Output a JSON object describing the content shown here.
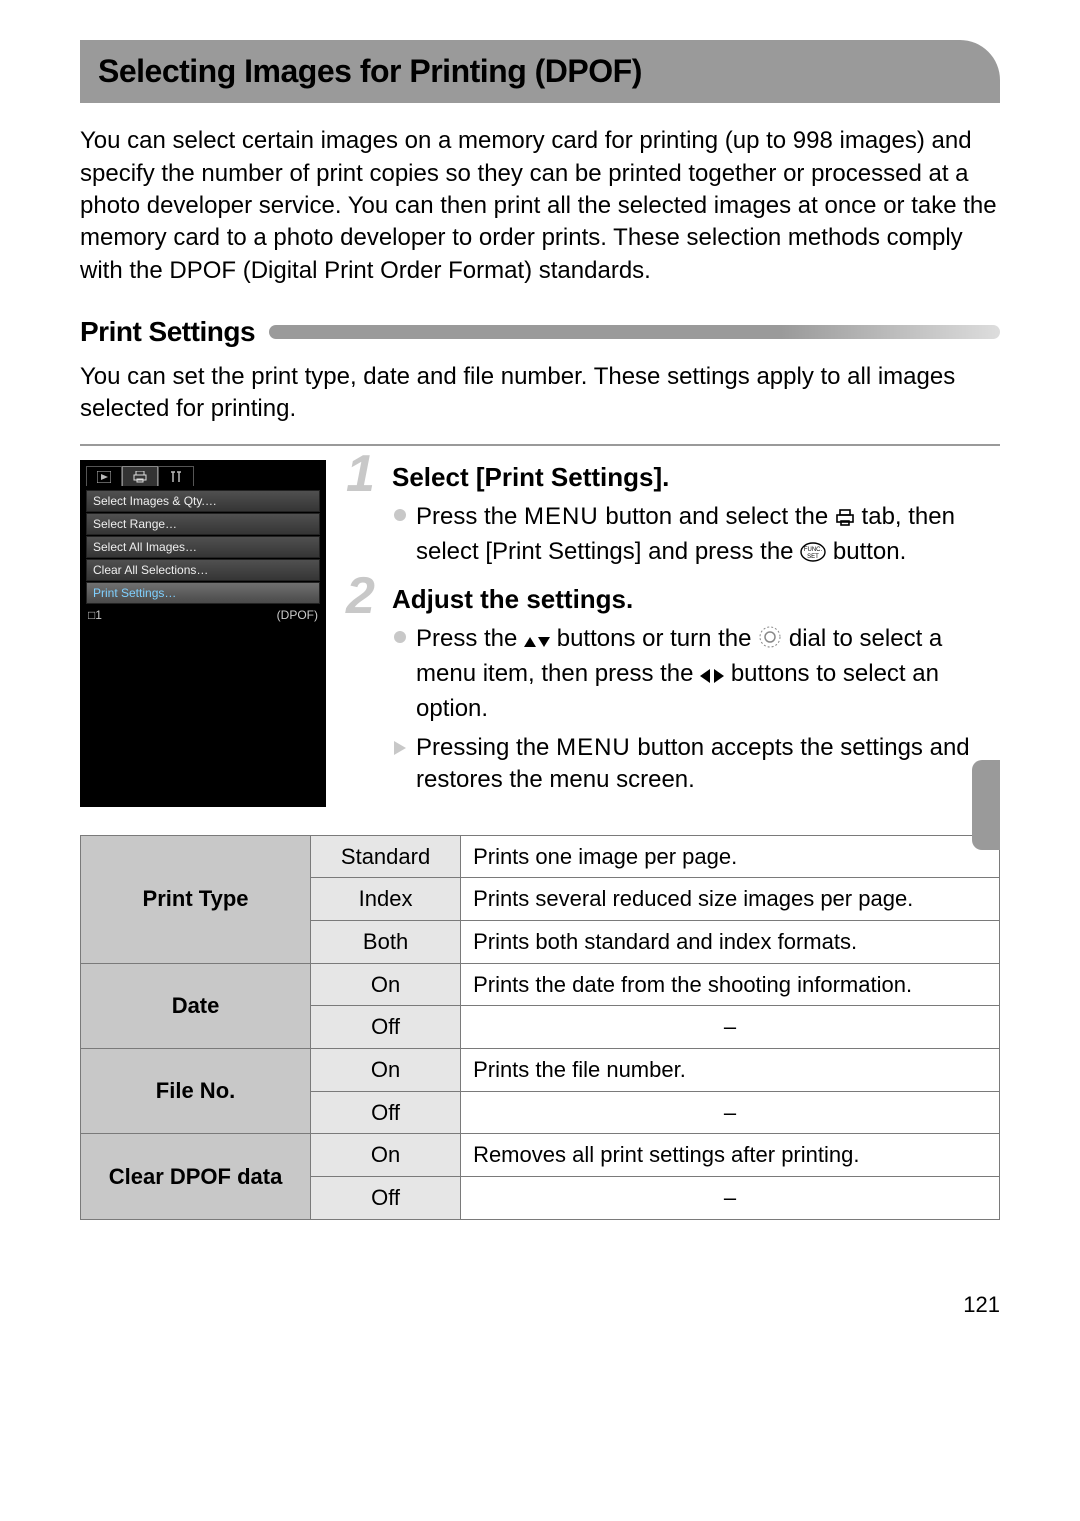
{
  "title": "Selecting Images for Printing (DPOF)",
  "intro": "You can select certain images on a memory card for printing (up to 998 images) and specify the number of print copies so they can be printed together or processed at a photo developer service. You can then print all the selected images at once or take the memory card to a photo developer to order prints. These selection methods comply with the DPOF (Digital Print Order Format) standards.",
  "subtitle": "Print Settings",
  "sub_desc": "You can set the print type, date and file number. These settings apply to all images selected for printing.",
  "camera_menu": {
    "items": [
      "Select Images & Qty.…",
      "Select Range…",
      "Select All Images…",
      "Clear All Selections…",
      "Print Settings…"
    ],
    "footer_left": "□1",
    "footer_right": "(DPOF)"
  },
  "steps": [
    {
      "num": "1",
      "heading": "Select [Print Settings].",
      "bullets": [
        {
          "type": "dot",
          "parts": [
            "Press the ",
            {
              "kind": "menu"
            },
            " button and select the ",
            {
              "kind": "print-icon"
            },
            " tab, then select [Print Settings] and press the ",
            {
              "kind": "func"
            },
            " button."
          ]
        }
      ]
    },
    {
      "num": "2",
      "heading": "Adjust the settings.",
      "bullets": [
        {
          "type": "dot",
          "parts": [
            "Press the ",
            {
              "kind": "updown"
            },
            " buttons or turn the ",
            {
              "kind": "dial"
            },
            " dial to select a menu item, then press the ",
            {
              "kind": "leftright"
            },
            " buttons to select an option."
          ]
        },
        {
          "type": "arrow",
          "parts": [
            "Pressing the ",
            {
              "kind": "menu"
            },
            " button accepts the settings and restores the menu screen."
          ]
        }
      ]
    }
  ],
  "table": [
    {
      "cat": "Print Type",
      "rows": [
        {
          "opt": "Standard",
          "desc": "Prints one image per page."
        },
        {
          "opt": "Index",
          "desc": "Prints several reduced size images per page."
        },
        {
          "opt": "Both",
          "desc": "Prints both standard and index formats."
        }
      ]
    },
    {
      "cat": "Date",
      "rows": [
        {
          "opt": "On",
          "desc": "Prints the date from the shooting information."
        },
        {
          "opt": "Off",
          "desc": "–",
          "dash": true
        }
      ]
    },
    {
      "cat": "File No.",
      "rows": [
        {
          "opt": "On",
          "desc": "Prints the file number."
        },
        {
          "opt": "Off",
          "desc": "–",
          "dash": true
        }
      ]
    },
    {
      "cat": "Clear DPOF data",
      "rows": [
        {
          "opt": "On",
          "desc": "Removes all print settings after printing."
        },
        {
          "opt": "Off",
          "desc": "–",
          "dash": true
        }
      ]
    }
  ],
  "page_number": "121"
}
